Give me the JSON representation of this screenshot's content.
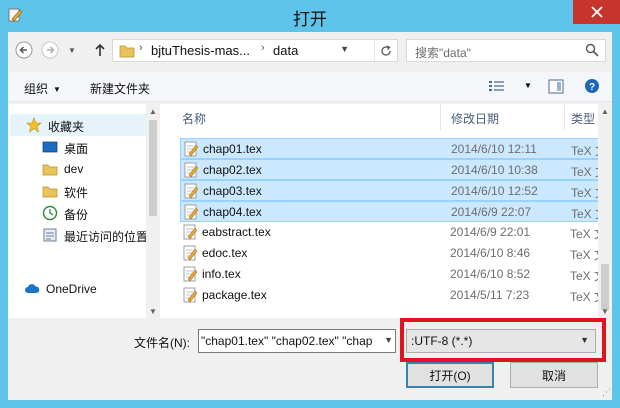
{
  "window": {
    "title": "打开",
    "title_bar_color": "#5ec4ea",
    "close_icon": "close-icon"
  },
  "address_bar": {
    "crumbs": [
      "bjtuThesis-mas...",
      "data"
    ],
    "search_placeholder": "搜索\"data\""
  },
  "toolbar": {
    "organize_label": "组织",
    "new_folder_label": "新建文件夹"
  },
  "nav_pane": {
    "favorites_label": "收藏夹",
    "items": [
      "桌面",
      "dev",
      "软件",
      "备份",
      "最近访问的位置"
    ],
    "onedrive_label": "OneDrive"
  },
  "file_list": {
    "columns": [
      "名称",
      "修改日期",
      "类型"
    ],
    "rows": [
      {
        "name": "chap01.tex",
        "date": "2014/6/10 12:11",
        "type": "TeX 文",
        "selected": true
      },
      {
        "name": "chap02.tex",
        "date": "2014/6/10 10:38",
        "type": "TeX 文",
        "selected": true
      },
      {
        "name": "chap03.tex",
        "date": "2014/6/10 12:52",
        "type": "TeX 文",
        "selected": true
      },
      {
        "name": "chap04.tex",
        "date": "2014/6/9 22:07",
        "type": "TeX 文",
        "selected": true
      },
      {
        "name": "eabstract.tex",
        "date": "2014/6/9 22:01",
        "type": "TeX 文",
        "selected": false
      },
      {
        "name": "edoc.tex",
        "date": "2014/6/10 8:46",
        "type": "TeX 文",
        "selected": false
      },
      {
        "name": "info.tex",
        "date": "2014/6/10 8:52",
        "type": "TeX 文",
        "selected": false
      },
      {
        "name": "package.tex",
        "date": "2014/5/11 7:23",
        "type": "TeX 文",
        "selected": false
      }
    ],
    "selection_color": "#cce8ff"
  },
  "bottom": {
    "filename_label": "文件名(N):",
    "filename_value": "\"chap01.tex\" \"chap02.tex\" \"chap",
    "filetype_value": ":UTF-8 (*.*)",
    "highlight_color": "#e0141e",
    "open_label": "打开(O)",
    "cancel_label": "取消"
  }
}
